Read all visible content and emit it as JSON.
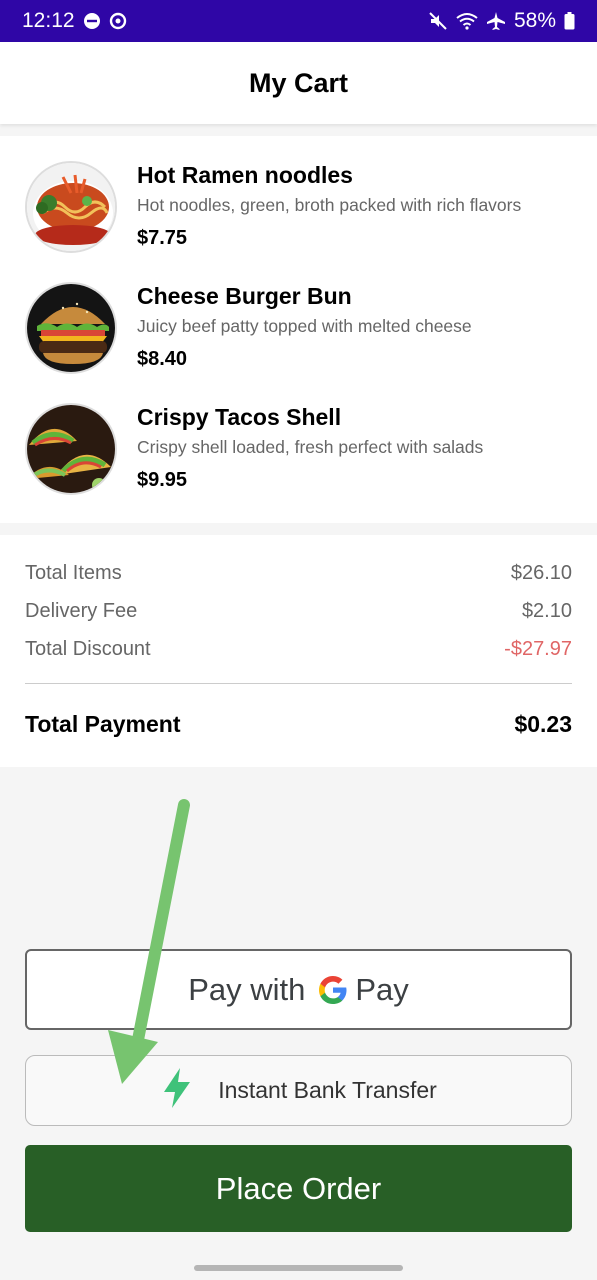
{
  "status_bar": {
    "time": "12:12",
    "battery": "58%",
    "icons": [
      "do-not-disturb-icon",
      "data-saver-icon",
      "mute-icon",
      "wifi-icon",
      "airplane-icon",
      "battery-icon"
    ]
  },
  "header": {
    "title": "My Cart"
  },
  "cart": {
    "items": [
      {
        "name": "Hot Ramen noodles",
        "description": "Hot noodles, green, broth packed with rich flavors",
        "price": "$7.75",
        "image": "ramen-image"
      },
      {
        "name": "Cheese Burger Bun",
        "description": "Juicy beef patty topped with melted cheese",
        "price": "$8.40",
        "image": "burger-image"
      },
      {
        "name": "Crispy Tacos Shell",
        "description": "Crispy shell loaded, fresh perfect with salads",
        "price": "$9.95",
        "image": "tacos-image"
      }
    ]
  },
  "summary": {
    "total_items_label": "Total Items",
    "total_items_value": "$26.10",
    "delivery_fee_label": "Delivery Fee",
    "delivery_fee_value": "$2.10",
    "total_discount_label": "Total Discount",
    "total_discount_value": "-$27.97",
    "total_payment_label": "Total Payment",
    "total_payment_value": "$0.23"
  },
  "payment": {
    "gpay_prefix": "Pay with",
    "gpay_logo_g": "G",
    "gpay_logo_pay": "Pay",
    "bank_transfer_label": "Instant Bank Transfer",
    "place_order_label": "Place Order"
  },
  "colors": {
    "status_bar": "#2f06a6",
    "place_order": "#285f26",
    "discount": "#e06666",
    "annotation_arrow": "#77c46f",
    "bolt": "#3fc27a"
  }
}
